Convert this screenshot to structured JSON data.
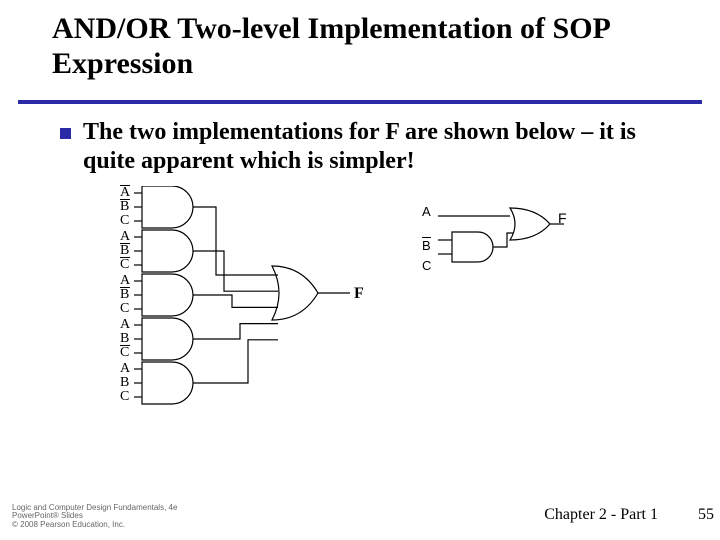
{
  "title": "AND/OR Two-level Implementation of SOP Expression",
  "bullet": "The two implementations for F are shown below – it is quite apparent which is simpler!",
  "left_circuit": {
    "gates": [
      {
        "inputs": [
          {
            "v": "A",
            "bar": true
          },
          {
            "v": "B",
            "bar": true
          },
          {
            "v": "C",
            "bar": false
          }
        ]
      },
      {
        "inputs": [
          {
            "v": "A",
            "bar": false
          },
          {
            "v": "B",
            "bar": true
          },
          {
            "v": "C",
            "bar": true
          }
        ]
      },
      {
        "inputs": [
          {
            "v": "A",
            "bar": false
          },
          {
            "v": "B",
            "bar": true
          },
          {
            "v": "C",
            "bar": false
          }
        ]
      },
      {
        "inputs": [
          {
            "v": "A",
            "bar": false
          },
          {
            "v": "B",
            "bar": false
          },
          {
            "v": "C",
            "bar": true
          }
        ]
      },
      {
        "inputs": [
          {
            "v": "A",
            "bar": false
          },
          {
            "v": "B",
            "bar": false
          },
          {
            "v": "C",
            "bar": false
          }
        ]
      }
    ],
    "output": "F"
  },
  "right_circuit": {
    "top_input": {
      "v": "A",
      "bar": false
    },
    "and_inputs": [
      {
        "v": "B",
        "bar": true
      },
      {
        "v": "C",
        "bar": false
      }
    ],
    "output": "F"
  },
  "footer": {
    "chapter": "Chapter 2 - Part 1",
    "page": "55"
  },
  "copyright": {
    "l1": "Logic and Computer Design Fundamentals, 4e",
    "l2": "PowerPoint® Slides",
    "l3": "© 2008 Pearson Education, Inc."
  }
}
